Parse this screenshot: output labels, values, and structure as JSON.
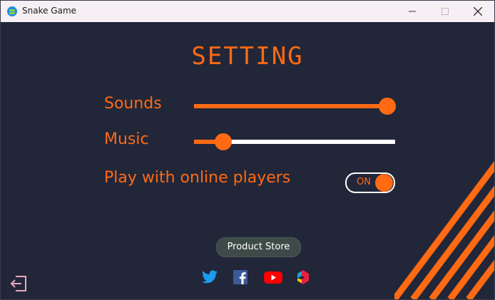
{
  "window": {
    "title": "Snake Game",
    "icons": {
      "app": "snake-app-icon",
      "minimize": "minimize-icon",
      "maximize": "maximize-icon",
      "close": "close-icon"
    }
  },
  "settings": {
    "heading": "SETTING",
    "sounds": {
      "label": "Sounds",
      "level": 0.96
    },
    "music": {
      "label": "Music",
      "level": 0.146
    },
    "online": {
      "label": "Play with online players",
      "toggle_text": "ON",
      "enabled": true
    }
  },
  "store": {
    "label": "Product Store"
  },
  "social": [
    "twitter-icon",
    "facebook-icon",
    "youtube-icon",
    "vidio-icon"
  ],
  "colors": {
    "accent": "#ff6a13",
    "background": "#222639",
    "track": "#ffffff",
    "store_button": "#3d4a47",
    "exit_icon": "#e8a9bf"
  }
}
